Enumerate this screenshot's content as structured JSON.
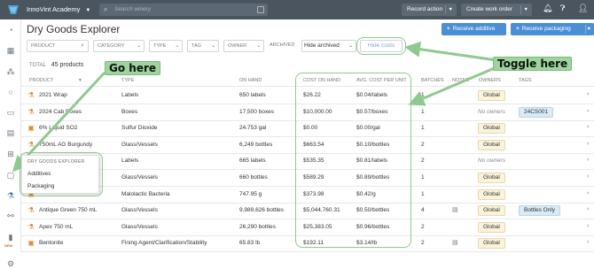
{
  "topbar": {
    "org_name": "InnoVint Academy",
    "search_placeholder": "Search winery",
    "record_action": "Record action",
    "create_work_order": "Create work order"
  },
  "page": {
    "title": "Dry Goods Explorer",
    "receive_additive": "Receive additive",
    "receive_packaging": "Receive packaging"
  },
  "filters": {
    "product": "PRODUCT",
    "category": "CATEGORY",
    "type": "TYPE",
    "tag": "TAG",
    "owner": "OWNER",
    "archived_label": "ARCHIVED",
    "archived_value": "Hide archived",
    "hide_costs": "Hide costs"
  },
  "summary": {
    "total_label": "TOTAL",
    "total_value": "45 products"
  },
  "columns": {
    "product": "PRODUCT",
    "type": "TYPE",
    "on_hand": "ON HAND",
    "cost_on_hand": "COST ON HAND",
    "avg_cost": "AVG. COST PER UNIT",
    "batches": "BATCHES",
    "notes": "NOTES",
    "owners": "OWNERS",
    "tags": "TAGS"
  },
  "rows": [
    {
      "product": "2021 Wrap",
      "type": "Labels",
      "on_hand": "650 labels",
      "cost": "$26.22",
      "avg": "$0.04/labels",
      "batches": "1",
      "owner": "Global",
      "tag": "",
      "note": false
    },
    {
      "product": "2024 Cab Boxes",
      "type": "Boxes",
      "on_hand": "17,500 boxes",
      "cost": "$10,000.00",
      "avg": "$0.57/boxes",
      "batches": "1",
      "owner": "No owners",
      "tag": "24CS001",
      "note": false
    },
    {
      "product": "6% Liquid SO2",
      "type": "Sulfur Dioxide",
      "on_hand": "24.753 gal",
      "cost": "$0.00",
      "avg": "$0.00/gal",
      "batches": "1",
      "owner": "Global",
      "tag": "",
      "note": false
    },
    {
      "product": "750mL AG Burgundy",
      "type": "Glass/Vessels",
      "on_hand": "6,249 bottles",
      "cost": "$663.54",
      "avg": "$0.10/bottles",
      "batches": "2",
      "owner": "Global",
      "tag": "",
      "note": false
    },
    {
      "product": "",
      "type": "Labels",
      "on_hand": "665 labels",
      "cost": "$535.35",
      "avg": "$0.81/labels",
      "batches": "2",
      "owner": "No owners",
      "tag": "",
      "note": false
    },
    {
      "product": "",
      "type": "Glass/Vessels",
      "on_hand": "660 bottles",
      "cost": "$589.29",
      "avg": "$0.89/bottles",
      "batches": "1",
      "owner": "Global",
      "tag": "",
      "note": false
    },
    {
      "product": "",
      "type": "Malolactic Bacteria",
      "on_hand": "747.95 g",
      "cost": "$373.98",
      "avg": "$0.42/g",
      "batches": "1",
      "owner": "Global",
      "tag": "",
      "note": false
    },
    {
      "product": "Antique Green 750 mL",
      "type": "Glass/Vessels",
      "on_hand": "9,989,626 bottles",
      "cost": "$5,044,760.31",
      "avg": "$0.50/bottles",
      "batches": "4",
      "owner": "Global",
      "tag": "Bottles Only",
      "note": true
    },
    {
      "product": "Apex 750 mL",
      "type": "Glass/Vessels",
      "on_hand": "26,290 bottles",
      "cost": "$25,383.05",
      "avg": "$0.96/bottles",
      "batches": "2",
      "owner": "Global",
      "tag": "",
      "note": false
    },
    {
      "product": "Bentonite",
      "type": "Fining Agent/Clarification/Stability",
      "on_hand": "65.83 lb",
      "cost": "$192.11",
      "avg": "$3.14/lb",
      "batches": "2",
      "owner": "Global",
      "tag": "",
      "note": true
    }
  ],
  "popup": {
    "header": "DRY GOODS EXPLORER",
    "items": [
      "Additives",
      "Packaging"
    ]
  },
  "sidebar": {
    "new_label": "NEW"
  },
  "annotations": {
    "go_here": "Go here",
    "toggle_here": "Toggle here"
  }
}
